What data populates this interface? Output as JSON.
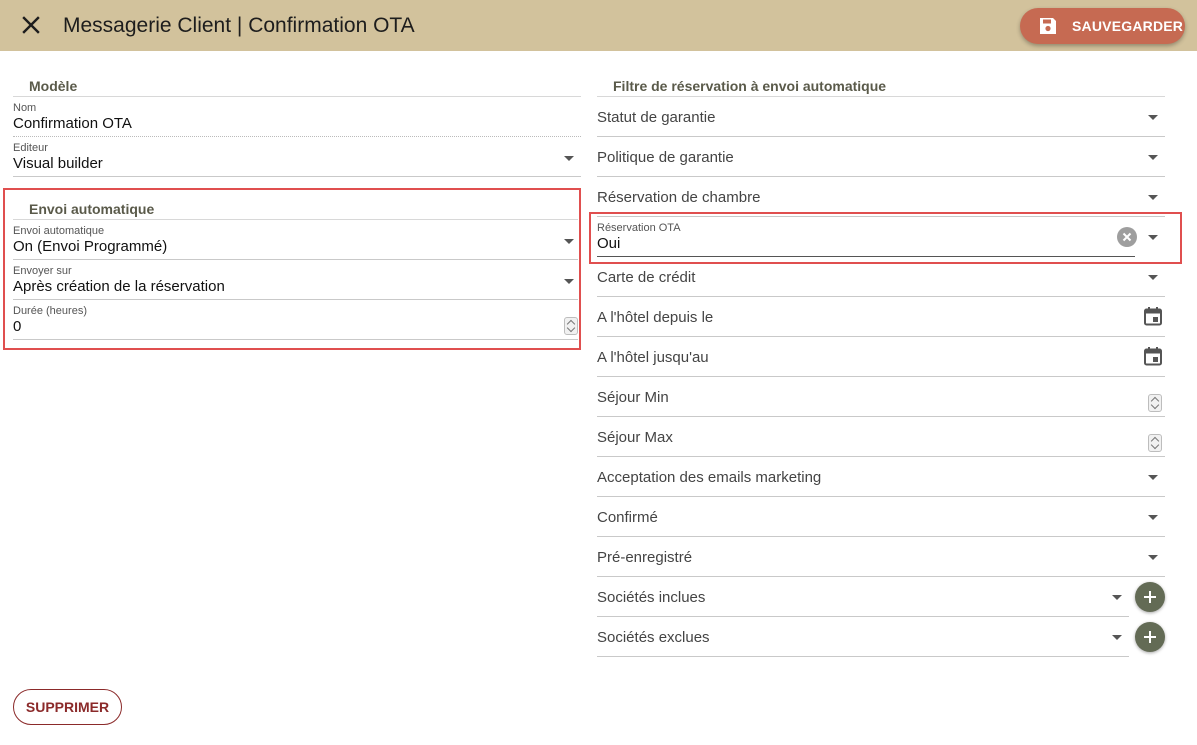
{
  "header": {
    "title": "Messagerie Client | Confirmation OTA",
    "save_label": "SAUVEGARDER",
    "accent": "#d2c29c",
    "save_color": "#c66a52"
  },
  "left": {
    "model_section": "Modèle",
    "nom_label": "Nom",
    "nom_value": "Confirmation OTA",
    "editeur_label": "Editeur",
    "editeur_value": "Visual builder",
    "envoi_section": "Envoi automatique",
    "envoi_label": "Envoi automatique",
    "envoi_value": "On (Envoi Programmé)",
    "envoyer_label": "Envoyer sur",
    "envoyer_value": "Après création de la réservation",
    "duree_label": "Durée (heures)",
    "duree_value": "0"
  },
  "right": {
    "section": "Filtre de réservation à envoi automatique",
    "statut": "Statut de garantie",
    "politique": "Politique de garantie",
    "chambre": "Réservation de chambre",
    "ota_label": "Réservation OTA",
    "ota_value": "Oui",
    "carte": "Carte de crédit",
    "depuis": "A l'hôtel depuis le",
    "jusqu": "A l'hôtel jusqu'au",
    "sejour_min": "Séjour Min",
    "sejour_max": "Séjour Max",
    "marketing": "Acceptation des emails marketing",
    "confirme": "Confirmé",
    "preenreg": "Pré-enregistré",
    "soc_incl": "Sociétés inclues",
    "soc_excl": "Sociétés exclues"
  },
  "footer": {
    "delete_label": "SUPPRIMER"
  },
  "icons": {
    "close": "close-icon",
    "save": "floppy-disk-icon",
    "calendar": "calendar-icon",
    "clear": "clear-circle-icon",
    "plus": "plus-icon",
    "dropdown": "chevron-down-icon"
  }
}
